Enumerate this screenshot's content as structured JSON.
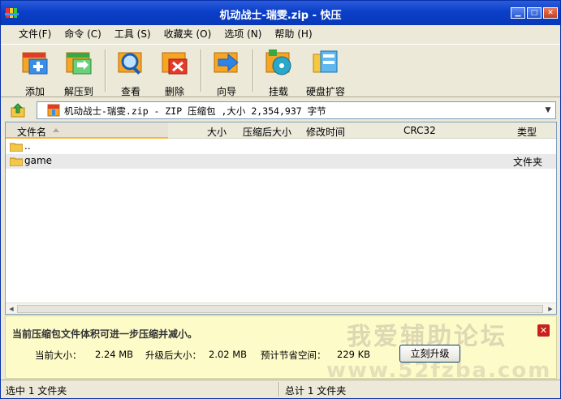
{
  "window": {
    "title": "机动战士-瑞雯.zip - 快压"
  },
  "menu": [
    "文件(F)",
    "命令 (C)",
    "工具 (S)",
    "收藏夹 (O)",
    "选项 (N)",
    "帮助 (H)"
  ],
  "toolbar": {
    "add": "添加",
    "extract": "解压到",
    "view": "查看",
    "delete": "删除",
    "wizard": "向导",
    "mount": "挂载",
    "disk_expand": "硬盘扩容"
  },
  "address": {
    "text": "机动战士-瑞雯.zip - ZIP 压缩包 ,大小 2,354,937 字节"
  },
  "columns": {
    "name": "文件名",
    "size": "大小",
    "packed": "压缩后大小",
    "modified": "修改时间",
    "crc": "CRC32",
    "type": "类型"
  },
  "rows": [
    {
      "name": "..",
      "type": ""
    },
    {
      "name": "game",
      "type": "文件夹"
    }
  ],
  "notice": {
    "message": "当前压缩包文件体积可进一步压缩并减小。",
    "current_size_label": "当前大小：",
    "current_size": "2.24 MB",
    "upgraded_size_label": "升级后大小：",
    "upgraded_size": "2.02 MB",
    "savings_label": "预计节省空间：",
    "savings": "229 KB",
    "upgrade_button": "立刻升级",
    "watermark": "我爱辅助论坛",
    "watermark_url": "www.52fzba.com"
  },
  "status": {
    "left": "选中 1 文件夹",
    "right": "总计 1 文件夹"
  },
  "colors": {
    "title_bar": "#0a3fc8",
    "notice_bg": "#fdfbc8",
    "accent_red": "#c8201b"
  }
}
